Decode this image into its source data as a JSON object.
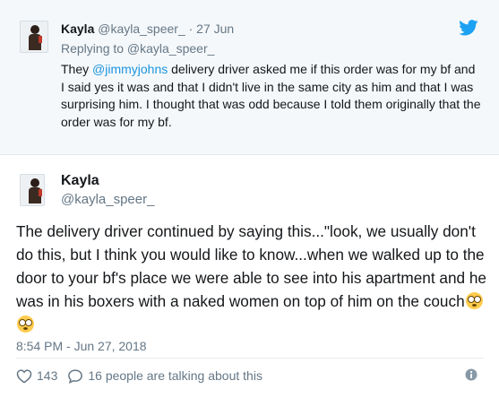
{
  "reply_tweet": {
    "display_name": "Kayla",
    "handle_date": "@kayla_speer_ · 27 Jun",
    "replying_to": "Replying to @kayla_speer_",
    "text_before_mention": "They ",
    "mention": "@jimmyjohns",
    "text_after_mention": " delivery driver asked me if this order was for my bf and I said yes it was and that I didn't live in the same city as him and that I was surprising him. I thought that was odd because I told them originally that the order was for my bf."
  },
  "main_tweet": {
    "display_name": "Kayla",
    "handle": "@kayla_speer_",
    "text": "The delivery driver continued by saying this...\"look, we usually don't do this, but I think you would like to know...when we walked up to the door to your bf's place we were able to see into his apartment and he was in his boxers with a naked women on top of him on the couch",
    "emojis": [
      "flushed-face",
      "flushed-face"
    ],
    "timestamp": "8:54 PM - Jun 27, 2018",
    "like_count": "143",
    "talking_text": "16 people are talking about this"
  },
  "icons": {
    "brand": "twitter-bird-icon",
    "like": "heart-icon",
    "reply": "speech-bubble-icon",
    "info": "info-icon"
  },
  "colors": {
    "twitter_blue": "#1da1f2",
    "mention_blue": "#1b95e0",
    "secondary_text": "#657786",
    "reply_background": "#f5f8fa"
  }
}
